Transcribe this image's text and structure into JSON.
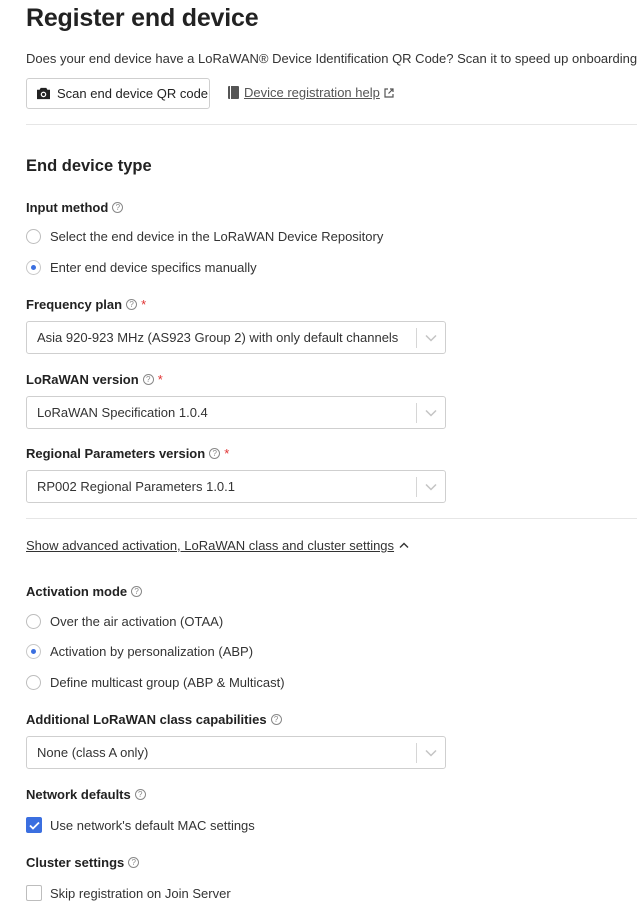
{
  "page": {
    "title": "Register end device",
    "intro": "Does your end device have a LoRaWAN® Device Identification QR Code? Scan it to speed up onboarding.",
    "scan_button_label": "Scan end device QR code",
    "help_link_label": "Device registration help"
  },
  "end_device_type": {
    "heading": "End device type",
    "input_method": {
      "label": "Input method",
      "options": [
        {
          "label": "Select the end device in the LoRaWAN Device Repository",
          "selected": false
        },
        {
          "label": "Enter end device specifics manually",
          "selected": true
        }
      ]
    },
    "frequency_plan": {
      "label": "Frequency plan",
      "required": "*",
      "value": "Asia 920-923 MHz (AS923 Group 2) with only default channels"
    },
    "lorawan_version": {
      "label": "LoRaWAN version",
      "required": "*",
      "value": "LoRaWAN Specification 1.0.4"
    },
    "regional_parameters": {
      "label": "Regional Parameters version",
      "required": "*",
      "value": "RP002 Regional Parameters 1.0.1"
    }
  },
  "advanced": {
    "toggle_label": "Show advanced activation, LoRaWAN class and cluster settings",
    "activation_mode": {
      "label": "Activation mode",
      "options": [
        {
          "label": "Over the air activation (OTAA)",
          "selected": false
        },
        {
          "label": "Activation by personalization (ABP)",
          "selected": true
        },
        {
          "label": "Define multicast group (ABP & Multicast)",
          "selected": false
        }
      ]
    },
    "class_capabilities": {
      "label": "Additional LoRaWAN class capabilities",
      "value": "None (class A only)"
    },
    "network_defaults": {
      "label": "Network defaults",
      "checkbox_label": "Use network's default MAC settings",
      "checked": true
    },
    "cluster_settings": {
      "label": "Cluster settings",
      "checkbox_label": "Skip registration on Join Server",
      "checked": false
    }
  },
  "colors": {
    "accent": "#3b6fe0",
    "required": "#e03131"
  }
}
